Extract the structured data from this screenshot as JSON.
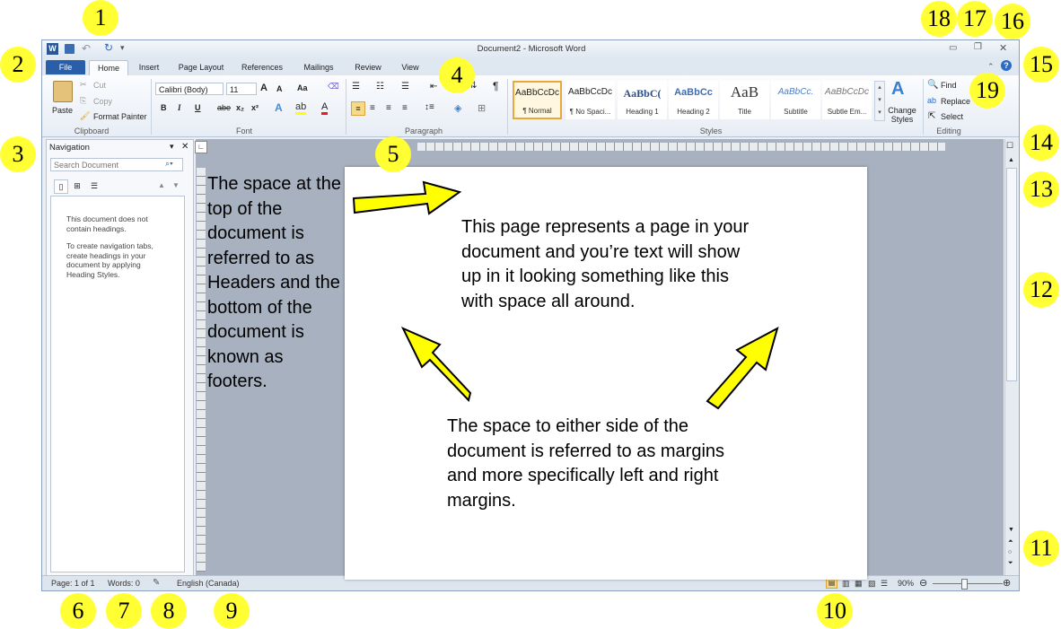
{
  "window": {
    "title": "Document2  -  Microsoft Word",
    "app_icon": "W"
  },
  "quick_access": {
    "save_icon": "save-icon",
    "undo_icon": "undo-icon",
    "redo_icon": "redo-icon"
  },
  "tabs": [
    "File",
    "Home",
    "Insert",
    "Page Layout",
    "References",
    "Mailings",
    "Review",
    "View"
  ],
  "clipboard": {
    "paste": "Paste",
    "cut": "Cut",
    "copy": "Copy",
    "format_painter": "Format Painter",
    "label": "Clipboard"
  },
  "font": {
    "family": "Calibri (Body)",
    "size": "11",
    "bold": "B",
    "italic": "I",
    "underline": "U",
    "strike": "abe",
    "sub": "x₂",
    "sup": "x²",
    "grow": "A",
    "shrink": "A",
    "case": "Aa",
    "label": "Font"
  },
  "paragraph": {
    "label": "Paragraph",
    "pilcrow": "¶"
  },
  "styles": {
    "label": "Styles",
    "items": [
      {
        "sample": "AaBbCcDc",
        "name": "¶ Normal"
      },
      {
        "sample": "AaBbCcDc",
        "name": "¶ No Spaci..."
      },
      {
        "sample": "AaBbC(",
        "name": "Heading 1"
      },
      {
        "sample": "AaBbCc",
        "name": "Heading 2"
      },
      {
        "sample": "AaB",
        "name": "Title"
      },
      {
        "sample": "AaBbCc.",
        "name": "Subtitle"
      },
      {
        "sample": "AaBbCcDc",
        "name": "Subtle Em..."
      }
    ],
    "change_styles": "Change Styles"
  },
  "editing": {
    "find": "Find",
    "replace": "Replace",
    "select": "Select",
    "label": "Editing"
  },
  "navigation": {
    "title": "Navigation",
    "search_placeholder": "Search Document",
    "msg1": "This document does not contain headings.",
    "msg2": "To create navigation tabs, create headings in your document by applying Heading Styles."
  },
  "status": {
    "page": "Page: 1 of 1",
    "words": "Words: 0",
    "language": "English (Canada)",
    "zoom": "90%"
  },
  "annotations": {
    "left_text": "The space at the top of the document is referred to as Headers and the bottom of the document is known as footers.",
    "page_text": "This page represents a page in your document and you’re text will show up in it looking something like this with space all around.",
    "bottom_text": "The space to either side of the document is referred to as margins and more specifically left and right margins."
  },
  "badges": [
    "1",
    "2",
    "3",
    "4",
    "5",
    "6",
    "7",
    "8",
    "9",
    "10",
    "11",
    "12",
    "13",
    "14",
    "15",
    "16",
    "17",
    "18",
    "19"
  ],
  "colors": {
    "file_tab": "#2a5ea8",
    "badge": "#ffff33",
    "arrow": "#ffff00"
  }
}
